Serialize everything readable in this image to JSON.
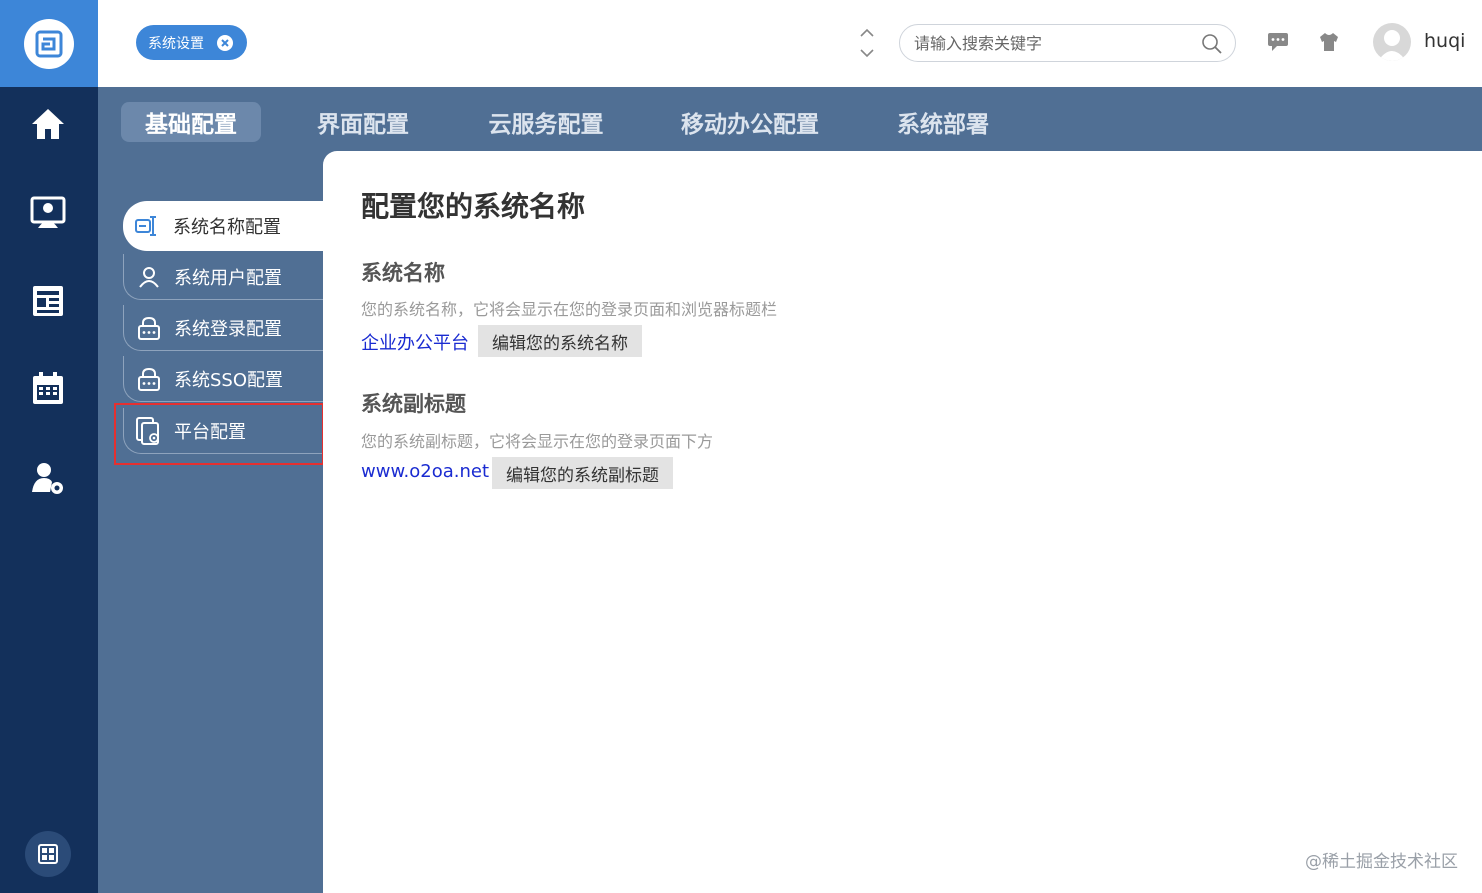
{
  "topbar": {
    "chip_label": "系统设置",
    "search_placeholder": "请输入搜索关键字",
    "username": "huqi"
  },
  "leftnav": {
    "items": [
      {
        "icon": "home-icon"
      },
      {
        "icon": "user-screen-icon"
      },
      {
        "icon": "news-icon"
      },
      {
        "icon": "calendar-icon"
      },
      {
        "icon": "user-settings-icon"
      }
    ],
    "apps_icon": "apps-grid-icon"
  },
  "tabs": [
    "基础配置",
    "界面配置",
    "云服务配置",
    "移动办公配置",
    "系统部署"
  ],
  "active_tab": "基础配置",
  "submenu": [
    {
      "label": "系统名称配置",
      "icon": "name-config-icon"
    },
    {
      "label": "系统用户配置",
      "icon": "user-icon"
    },
    {
      "label": "系统登录配置",
      "icon": "lock-icon"
    },
    {
      "label": "系统SSO配置",
      "icon": "lock-icon"
    },
    {
      "label": "平台配置",
      "icon": "platform-config-icon"
    }
  ],
  "content": {
    "title": "配置您的系统名称",
    "name_section": {
      "title": "系统名称",
      "desc": "您的系统名称，它将会显示在您的登录页面和浏览器标题栏",
      "value": "企业办公平台",
      "button": "编辑您的系统名称"
    },
    "subtitle_section": {
      "title": "系统副标题",
      "desc": "您的系统副标题，它将会显示在您的登录页面下方",
      "value": "www.o2oa.net",
      "button": "编辑您的系统副标题"
    }
  },
  "watermark": "@稀土掘金技术社区",
  "colors": {
    "leftnav_bg": "#13305b",
    "accent": "#3d86d8",
    "settings_bg": "#506f94",
    "highlight": "#e63030",
    "link": "#1a2bd1"
  }
}
